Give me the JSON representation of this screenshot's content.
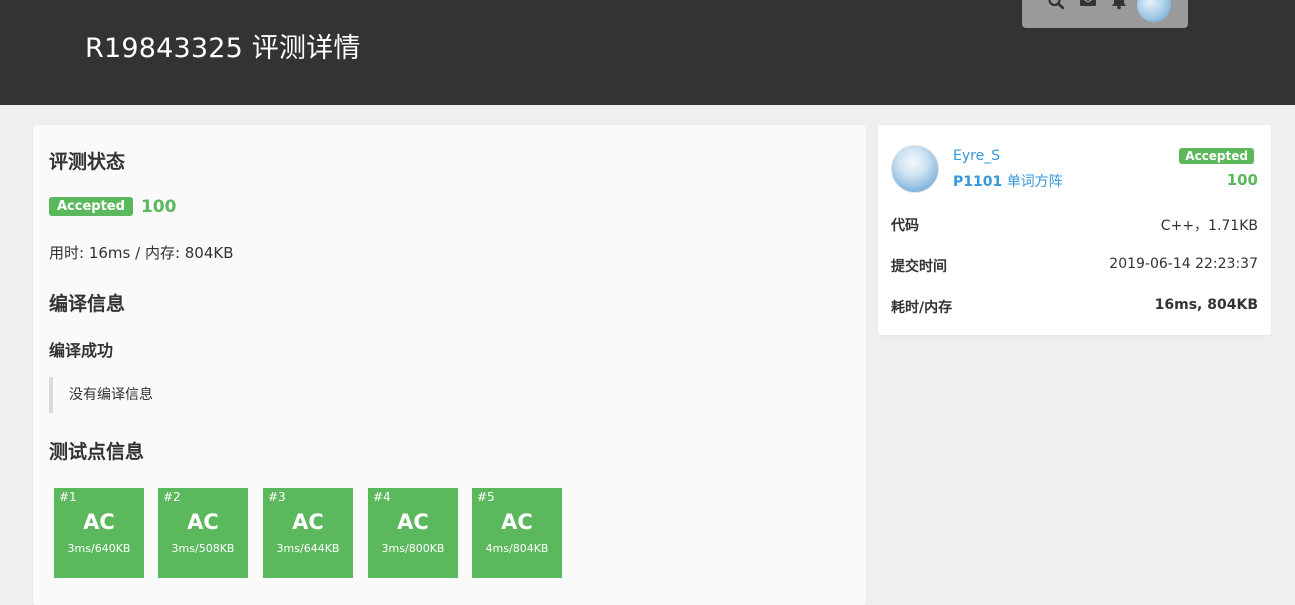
{
  "header": {
    "title": "R19843325 评测详情",
    "icons": [
      "search-icon",
      "mail-icon",
      "bell-icon",
      "user-avatar"
    ]
  },
  "main": {
    "status_heading": "评测状态",
    "status_badge": "Accepted",
    "score": "100",
    "usage_prefix": "用时: ",
    "usage_time": "16ms",
    "usage_sep": " / ",
    "usage_mem_prefix": "内存: ",
    "usage_mem": "804KB",
    "compile_heading": "编译信息",
    "compile_status": "编译成功",
    "compile_message": "没有编译信息",
    "testcases_heading": "测试点信息",
    "testcases": [
      {
        "num": "#1",
        "result": "AC",
        "meta": "3ms/640KB"
      },
      {
        "num": "#2",
        "result": "AC",
        "meta": "3ms/508KB"
      },
      {
        "num": "#3",
        "result": "AC",
        "meta": "3ms/644KB"
      },
      {
        "num": "#4",
        "result": "AC",
        "meta": "3ms/800KB"
      },
      {
        "num": "#5",
        "result": "AC",
        "meta": "4ms/804KB"
      }
    ]
  },
  "side": {
    "username": "Eyre_S",
    "problem_id": "P1101",
    "problem_name": "单词方阵",
    "status_badge": "Accepted",
    "score": "100",
    "rows": [
      {
        "label": "代码",
        "value": "C++，1.71KB"
      },
      {
        "label": "提交时间",
        "value": "2019-06-14 22:23:37"
      },
      {
        "label": "耗时/内存",
        "value": "16ms, 804KB"
      }
    ]
  },
  "colors": {
    "accent_green": "#5cb85c",
    "link_blue": "#3498db",
    "topbar": "#333333"
  }
}
